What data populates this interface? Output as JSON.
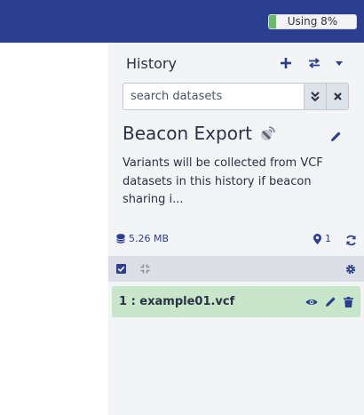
{
  "quota": {
    "label": "Using 8%",
    "fraction": 0.08
  },
  "history": {
    "title": "History",
    "search_placeholder": "search datasets",
    "name": "Beacon Export",
    "annotation": "Variants will be collected from VCF datasets in this history if beacon sharing i...",
    "size": "5.26 MB",
    "shown_count": "1"
  },
  "dataset": {
    "hid_name": "1 : example01.vcf",
    "state_color": "#c8e6c9"
  },
  "colors": {
    "masthead": "#2c3e8f",
    "accent": "#2c3e8f",
    "ok": "#c8e6c9"
  },
  "icons": [
    "plus-icon",
    "exchange-icon",
    "caret-down-icon",
    "angle-double-down-icon",
    "times-icon",
    "satellite-dish-icon",
    "pencil-icon",
    "database-icon",
    "map-marker-icon",
    "sync-icon",
    "check-square-icon",
    "compress-icon",
    "gear-icon",
    "eye-icon",
    "trash-icon"
  ]
}
